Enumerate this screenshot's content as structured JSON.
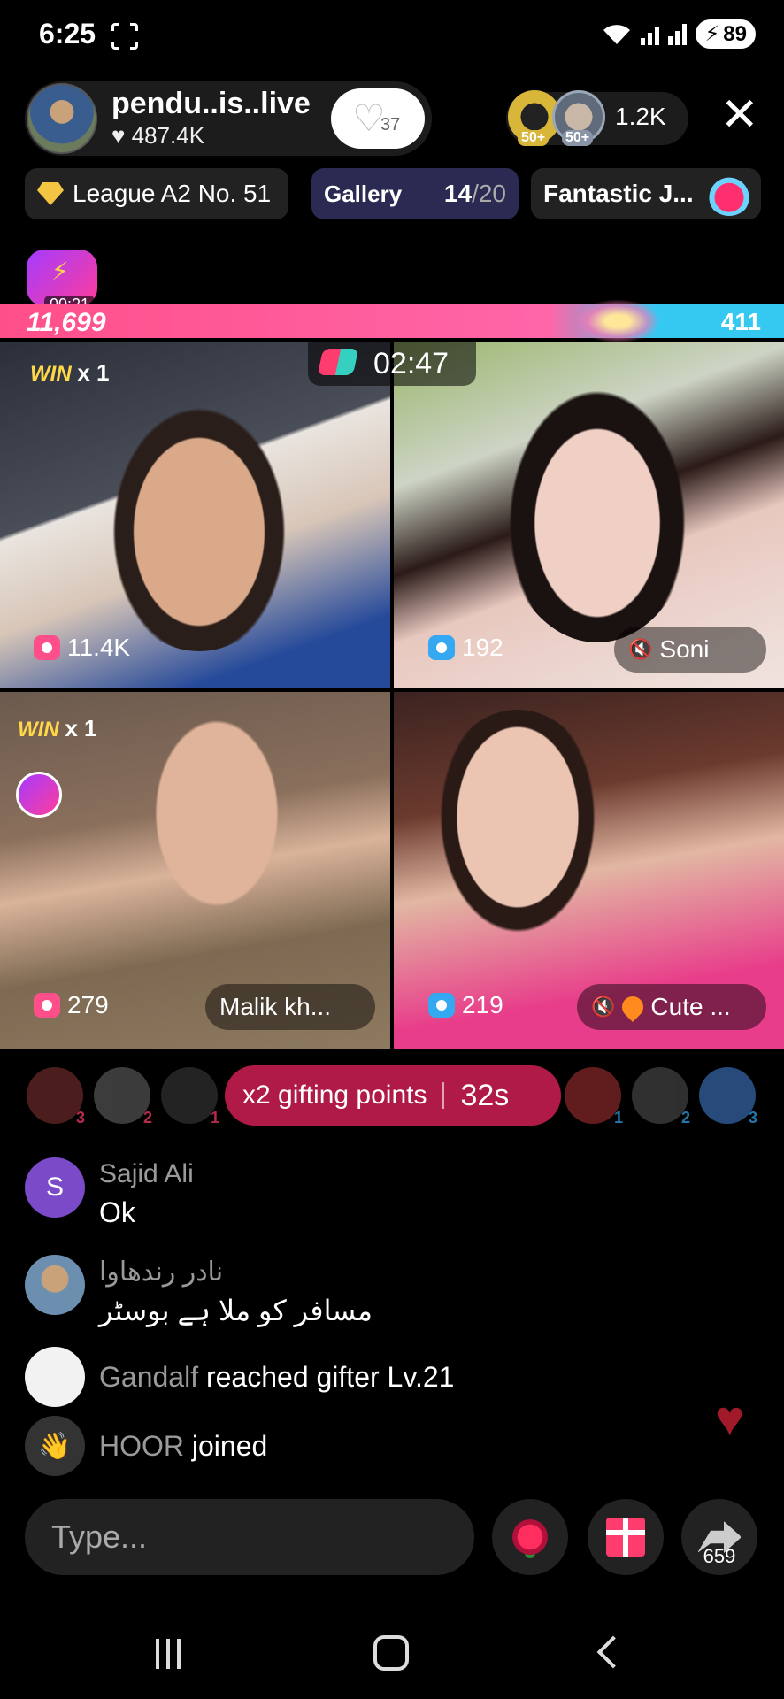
{
  "status": {
    "time": "6:25",
    "battery": "89"
  },
  "host": {
    "name": "pendu..is..live",
    "likes": "487.4K",
    "follow_count": "37"
  },
  "viewers": {
    "badge_left": "50+",
    "badge_right": "50+",
    "count": "1.2K"
  },
  "chips": {
    "league": "League A2 No. 51",
    "gallery_label": "Gallery",
    "gallery_current": "14",
    "gallery_total": "/20",
    "fantastic": "Fantastic J..."
  },
  "battle": {
    "lightning_timer": "00:21",
    "left_score": "11,699",
    "right_score": "411",
    "timer": "02:47"
  },
  "tiles": [
    {
      "win_label": "WIN",
      "win_count": "x 1",
      "score": "11.4K",
      "score_color": "#ff4f8a"
    },
    {
      "score": "192",
      "name": "Soni",
      "score_color": "#35a8f2"
    },
    {
      "win_label": "WIN",
      "win_count": "x 1",
      "score": "279",
      "name": "Malik kh...",
      "score_color": "#ff4f8a"
    },
    {
      "score": "219",
      "name": "Cute ...",
      "score_color": "#35a8f2"
    }
  ],
  "gifting": {
    "label": "x2 gifting points",
    "seconds": "32s",
    "left_ranks": [
      "3",
      "2",
      "1"
    ],
    "right_ranks": [
      "1",
      "2",
      "3"
    ]
  },
  "chat": [
    {
      "avatar_letter": "S",
      "user": "Sajid Ali",
      "message": "Ok"
    },
    {
      "user": "نادر رندھاوا",
      "message": "مسافر کو ملا ہے بوسٹر"
    },
    {
      "user": "Gandalf",
      "message": "reached gifter Lv.21"
    },
    {
      "user": "HOOR",
      "message": "joined"
    }
  ],
  "input": {
    "placeholder": "Type..."
  },
  "share": {
    "count": "659"
  },
  "colors": {
    "accent_pink": "#ff4f8a",
    "accent_blue": "#35c9f2",
    "gifting_pill": "#b01a47"
  }
}
